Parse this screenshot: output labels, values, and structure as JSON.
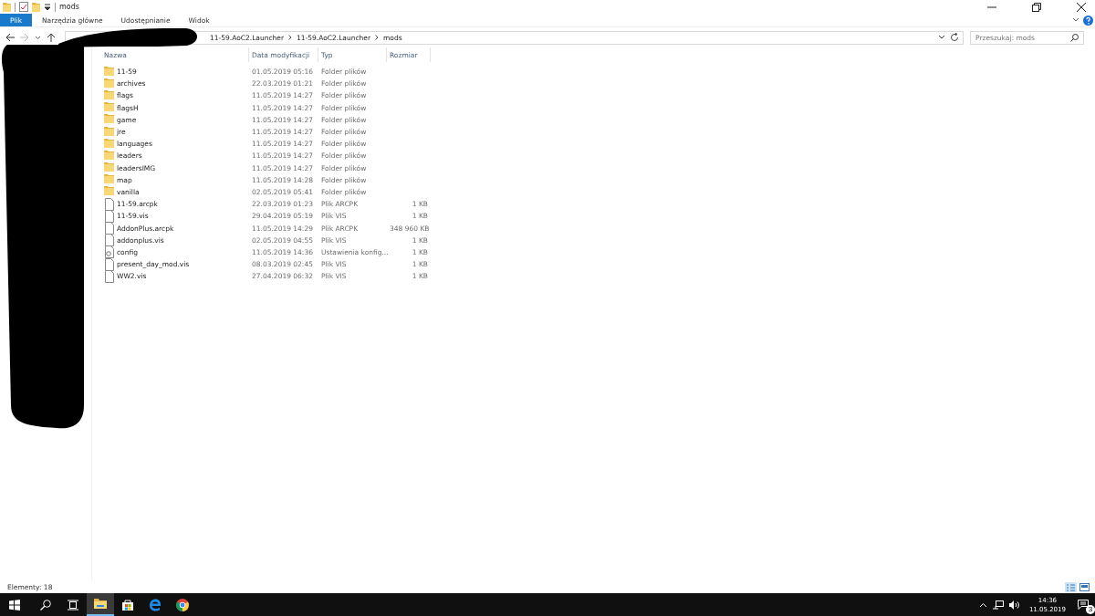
{
  "window": {
    "title": "mods"
  },
  "ribbon_tabs": [
    {
      "label": "Plik",
      "selected": true
    },
    {
      "label": "Narzędzia główne",
      "selected": false
    },
    {
      "label": "Udostępnianie",
      "selected": false
    },
    {
      "label": "Widok",
      "selected": false
    }
  ],
  "address_bar": {
    "path": [
      "11-59.AoC2.Launcher",
      "11-59.AoC2.Launcher",
      "mods"
    ]
  },
  "search": {
    "placeholder": "Przeszukaj: mods"
  },
  "table": {
    "columns": [
      "Nazwa",
      "Data modyfikacji",
      "Typ",
      "Rozmiar"
    ],
    "rows": [
      {
        "kind": "folder",
        "name": "11-59",
        "date": "01.05.2019 05:16",
        "type": "Folder plików"
      },
      {
        "kind": "folder",
        "name": "archives",
        "date": "22.03.2019 01:21",
        "type": "Folder plików"
      },
      {
        "kind": "folder",
        "name": "flags",
        "date": "11.05.2019 14:27",
        "type": "Folder plików"
      },
      {
        "kind": "folder",
        "name": "flagsH",
        "date": "11.05.2019 14:27",
        "type": "Folder plików"
      },
      {
        "kind": "folder",
        "name": "game",
        "date": "11.05.2019 14:27",
        "type": "Folder plików"
      },
      {
        "kind": "folder",
        "name": "jre",
        "date": "11.05.2019 14:27",
        "type": "Folder plików"
      },
      {
        "kind": "folder",
        "name": "languages",
        "date": "11.05.2019 14:27",
        "type": "Folder plików"
      },
      {
        "kind": "folder",
        "name": "leaders",
        "date": "11.05.2019 14:27",
        "type": "Folder plików"
      },
      {
        "kind": "folder",
        "name": "leadersIMG",
        "date": "11.05.2019 14:27",
        "type": "Folder plików"
      },
      {
        "kind": "folder",
        "name": "map",
        "date": "11.05.2019 14:28",
        "type": "Folder plików"
      },
      {
        "kind": "folder",
        "name": "vanilla",
        "date": "02.05.2019 05:41",
        "type": "Folder plików"
      },
      {
        "kind": "file",
        "name": "11-59.arcpk",
        "date": "22.03.2019 01:23",
        "type": "Plik ARCPK",
        "size": "1 KB"
      },
      {
        "kind": "file",
        "name": "11-59.vis",
        "date": "29.04.2019 05:19",
        "type": "Plik VIS",
        "size": "1 KB"
      },
      {
        "kind": "file",
        "name": "AddonPlus.arcpk",
        "date": "11.05.2019 14:29",
        "type": "Plik ARCPK",
        "size": "348 960 KB"
      },
      {
        "kind": "file",
        "name": "addonplus.vis",
        "date": "02.05.2019 04:55",
        "type": "Plik VIS",
        "size": "1 KB"
      },
      {
        "kind": "config",
        "name": "config",
        "date": "11.05.2019 14:36",
        "type": "Ustawienia konfig...",
        "size": "1 KB"
      },
      {
        "kind": "file",
        "name": "present_day_mod.vis",
        "date": "08.03.2019 02:45",
        "type": "Plik VIS",
        "size": "1 KB"
      },
      {
        "kind": "file",
        "name": "WW2.vis",
        "date": "27.04.2019 06:32",
        "type": "Plik VIS",
        "size": "1 KB"
      }
    ]
  },
  "status_bar": {
    "text": "Elementy: 18"
  },
  "taskbar": {
    "apps": [
      {
        "kind": "search",
        "selected": false
      },
      {
        "kind": "taskview",
        "selected": false
      },
      {
        "kind": "explorer",
        "selected": true
      },
      {
        "kind": "store",
        "selected": false
      },
      {
        "kind": "edge",
        "selected": false
      },
      {
        "kind": "chrome",
        "selected": false
      }
    ],
    "time": "14:36",
    "date": "11.05.2019",
    "notifications": "3"
  }
}
